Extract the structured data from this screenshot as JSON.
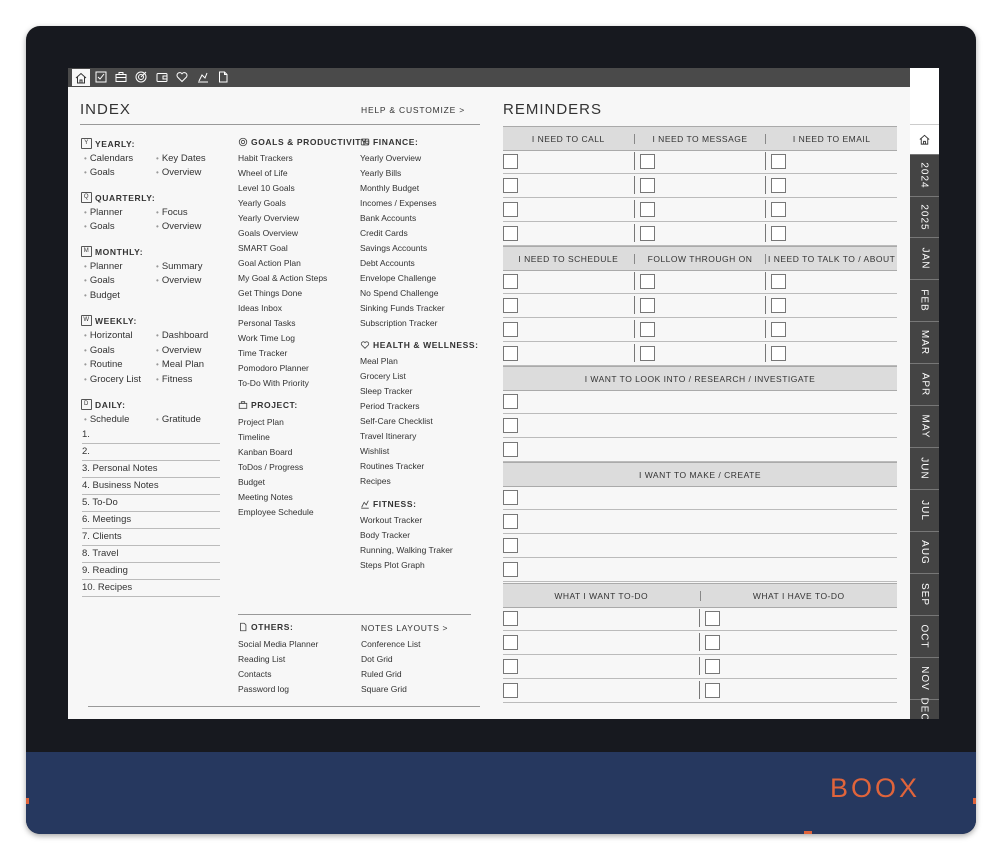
{
  "device": {
    "brand": "BOOX"
  },
  "toolbar": {
    "icons": [
      "home-icon",
      "checklist-icon",
      "briefcase-icon",
      "goal-icon",
      "wallet-icon",
      "heart-icon",
      "fitness-icon",
      "document-icon"
    ]
  },
  "tabs": {
    "months": [
      "2024",
      "2025",
      "JAN",
      "FEB",
      "MAR",
      "APR",
      "MAY",
      "JUN",
      "JUL",
      "AUG",
      "SEP",
      "OCT",
      "NOV",
      "DEC"
    ]
  },
  "index": {
    "title": "INDEX",
    "help": "HELP & CUSTOMIZE >",
    "yearly": {
      "header": "YEARLY:",
      "items": [
        "Calendars",
        "Key Dates",
        "Goals",
        "Overview"
      ]
    },
    "quarterly": {
      "header": "QUARTERLY:",
      "items": [
        "Planner",
        "Focus",
        "Goals",
        "Overview"
      ]
    },
    "monthly": {
      "header": "MONTHLY:",
      "items": [
        "Planner",
        "Summary",
        "Goals",
        "Overview",
        "Budget"
      ]
    },
    "weekly": {
      "header": "WEEKLY:",
      "items": [
        "Horizontal",
        "Dashboard",
        "Goals",
        "Overview",
        "Routine",
        "Meal Plan",
        "Grocery List",
        "Fitness"
      ]
    },
    "daily": {
      "header": "DAILY:",
      "items": [
        "Schedule",
        "Gratitude"
      ]
    },
    "notes": [
      "1.",
      "2.",
      "3. Personal Notes",
      "4. Business Notes",
      "5. To-Do",
      "6. Meetings",
      "7. Clients",
      "8. Travel",
      "9. Reading",
      "10. Recipes"
    ],
    "goals": {
      "header": "GOALS & PRODUCTIVITY:",
      "items": [
        "Habit Trackers",
        "Wheel of Life",
        "Level 10 Goals",
        "Yearly Goals",
        "Yearly Overview",
        "Goals Overview",
        "SMART Goal",
        "Goal Action Plan",
        "My Goal & Action Steps",
        "Get Things Done",
        "Ideas Inbox",
        "Personal Tasks",
        "Work Time Log",
        "Time Tracker",
        "Pomodoro Planner",
        "To-Do With Priority"
      ]
    },
    "project": {
      "header": "PROJECT:",
      "items": [
        "Project Plan",
        "Timeline",
        "Kanban Board",
        "ToDos / Progress",
        "Budget",
        "Meeting Notes",
        "Employee Schedule"
      ]
    },
    "finance": {
      "header": "FINANCE:",
      "items": [
        "Yearly Overview",
        "Yearly Bills",
        "Monthly Budget",
        "Incomes / Expenses",
        "Bank Accounts",
        "Credit Cards",
        "Savings Accounts",
        "Debt Accounts",
        "Envelope Challenge",
        "No Spend Challenge",
        "Sinking Funds Tracker",
        "Subscription Tracker"
      ]
    },
    "health": {
      "header": "HEALTH & WELLNESS:",
      "items": [
        "Meal Plan",
        "Grocery List",
        "Sleep Tracker",
        "Period Trackers",
        "Self-Care Checklist",
        "Travel Itinerary",
        "Wishlist",
        "Routines Tracker",
        "Recipes"
      ]
    },
    "fitness": {
      "header": "FITNESS:",
      "items": [
        "Workout Tracker",
        "Body Tracker",
        "Running, Walking Traker",
        "Steps Plot Graph"
      ]
    },
    "others": {
      "header": "OTHERS:",
      "items": [
        "Social Media Planner",
        "Reading List",
        "Contacts",
        "Password log"
      ]
    },
    "notes_layouts": {
      "header": "NOTES LAYOUTS >",
      "items": [
        "Conference List",
        "Dot Grid",
        "Ruled Grid",
        "Square Grid"
      ]
    }
  },
  "reminders": {
    "title": "REMINDERS",
    "band1": [
      "I NEED TO CALL",
      "I NEED TO MESSAGE",
      "I NEED TO EMAIL"
    ],
    "band2": [
      "I NEED TO SCHEDULE",
      "FOLLOW THROUGH ON",
      "I NEED TO TALK TO / ABOUT"
    ],
    "band3": "I WANT TO LOOK INTO / RESEARCH / INVESTIGATE",
    "band4": "I WANT TO MAKE / CREATE",
    "band5": [
      "WHAT I WANT TO-DO",
      "WHAT I HAVE TO-DO"
    ]
  }
}
